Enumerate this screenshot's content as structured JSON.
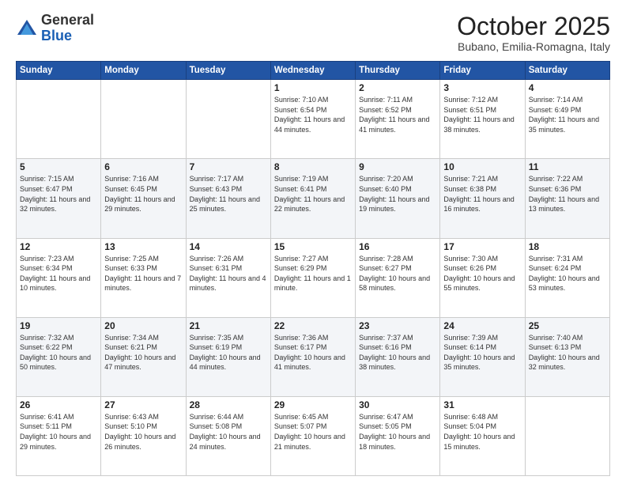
{
  "logo": {
    "line1": "General",
    "line2": "Blue"
  },
  "header": {
    "month": "October 2025",
    "location": "Bubano, Emilia-Romagna, Italy"
  },
  "weekdays": [
    "Sunday",
    "Monday",
    "Tuesday",
    "Wednesday",
    "Thursday",
    "Friday",
    "Saturday"
  ],
  "weeks": [
    [
      {
        "day": "",
        "info": ""
      },
      {
        "day": "",
        "info": ""
      },
      {
        "day": "",
        "info": ""
      },
      {
        "day": "1",
        "info": "Sunrise: 7:10 AM\nSunset: 6:54 PM\nDaylight: 11 hours and 44 minutes."
      },
      {
        "day": "2",
        "info": "Sunrise: 7:11 AM\nSunset: 6:52 PM\nDaylight: 11 hours and 41 minutes."
      },
      {
        "day": "3",
        "info": "Sunrise: 7:12 AM\nSunset: 6:51 PM\nDaylight: 11 hours and 38 minutes."
      },
      {
        "day": "4",
        "info": "Sunrise: 7:14 AM\nSunset: 6:49 PM\nDaylight: 11 hours and 35 minutes."
      }
    ],
    [
      {
        "day": "5",
        "info": "Sunrise: 7:15 AM\nSunset: 6:47 PM\nDaylight: 11 hours and 32 minutes."
      },
      {
        "day": "6",
        "info": "Sunrise: 7:16 AM\nSunset: 6:45 PM\nDaylight: 11 hours and 29 minutes."
      },
      {
        "day": "7",
        "info": "Sunrise: 7:17 AM\nSunset: 6:43 PM\nDaylight: 11 hours and 25 minutes."
      },
      {
        "day": "8",
        "info": "Sunrise: 7:19 AM\nSunset: 6:41 PM\nDaylight: 11 hours and 22 minutes."
      },
      {
        "day": "9",
        "info": "Sunrise: 7:20 AM\nSunset: 6:40 PM\nDaylight: 11 hours and 19 minutes."
      },
      {
        "day": "10",
        "info": "Sunrise: 7:21 AM\nSunset: 6:38 PM\nDaylight: 11 hours and 16 minutes."
      },
      {
        "day": "11",
        "info": "Sunrise: 7:22 AM\nSunset: 6:36 PM\nDaylight: 11 hours and 13 minutes."
      }
    ],
    [
      {
        "day": "12",
        "info": "Sunrise: 7:23 AM\nSunset: 6:34 PM\nDaylight: 11 hours and 10 minutes."
      },
      {
        "day": "13",
        "info": "Sunrise: 7:25 AM\nSunset: 6:33 PM\nDaylight: 11 hours and 7 minutes."
      },
      {
        "day": "14",
        "info": "Sunrise: 7:26 AM\nSunset: 6:31 PM\nDaylight: 11 hours and 4 minutes."
      },
      {
        "day": "15",
        "info": "Sunrise: 7:27 AM\nSunset: 6:29 PM\nDaylight: 11 hours and 1 minute."
      },
      {
        "day": "16",
        "info": "Sunrise: 7:28 AM\nSunset: 6:27 PM\nDaylight: 10 hours and 58 minutes."
      },
      {
        "day": "17",
        "info": "Sunrise: 7:30 AM\nSunset: 6:26 PM\nDaylight: 10 hours and 55 minutes."
      },
      {
        "day": "18",
        "info": "Sunrise: 7:31 AM\nSunset: 6:24 PM\nDaylight: 10 hours and 53 minutes."
      }
    ],
    [
      {
        "day": "19",
        "info": "Sunrise: 7:32 AM\nSunset: 6:22 PM\nDaylight: 10 hours and 50 minutes."
      },
      {
        "day": "20",
        "info": "Sunrise: 7:34 AM\nSunset: 6:21 PM\nDaylight: 10 hours and 47 minutes."
      },
      {
        "day": "21",
        "info": "Sunrise: 7:35 AM\nSunset: 6:19 PM\nDaylight: 10 hours and 44 minutes."
      },
      {
        "day": "22",
        "info": "Sunrise: 7:36 AM\nSunset: 6:17 PM\nDaylight: 10 hours and 41 minutes."
      },
      {
        "day": "23",
        "info": "Sunrise: 7:37 AM\nSunset: 6:16 PM\nDaylight: 10 hours and 38 minutes."
      },
      {
        "day": "24",
        "info": "Sunrise: 7:39 AM\nSunset: 6:14 PM\nDaylight: 10 hours and 35 minutes."
      },
      {
        "day": "25",
        "info": "Sunrise: 7:40 AM\nSunset: 6:13 PM\nDaylight: 10 hours and 32 minutes."
      }
    ],
    [
      {
        "day": "26",
        "info": "Sunrise: 6:41 AM\nSunset: 5:11 PM\nDaylight: 10 hours and 29 minutes."
      },
      {
        "day": "27",
        "info": "Sunrise: 6:43 AM\nSunset: 5:10 PM\nDaylight: 10 hours and 26 minutes."
      },
      {
        "day": "28",
        "info": "Sunrise: 6:44 AM\nSunset: 5:08 PM\nDaylight: 10 hours and 24 minutes."
      },
      {
        "day": "29",
        "info": "Sunrise: 6:45 AM\nSunset: 5:07 PM\nDaylight: 10 hours and 21 minutes."
      },
      {
        "day": "30",
        "info": "Sunrise: 6:47 AM\nSunset: 5:05 PM\nDaylight: 10 hours and 18 minutes."
      },
      {
        "day": "31",
        "info": "Sunrise: 6:48 AM\nSunset: 5:04 PM\nDaylight: 10 hours and 15 minutes."
      },
      {
        "day": "",
        "info": ""
      }
    ]
  ]
}
